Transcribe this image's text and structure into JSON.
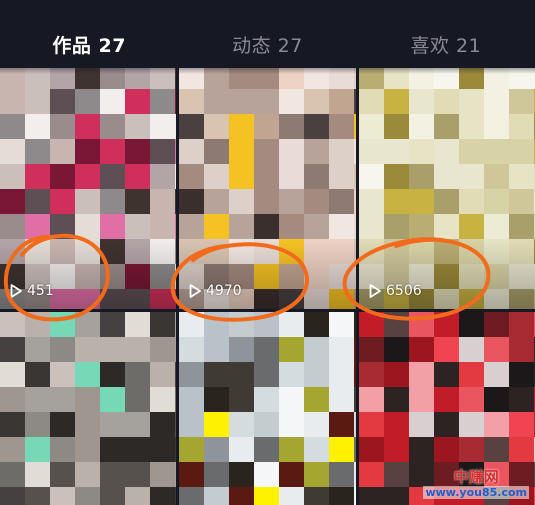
{
  "tabs": [
    {
      "label": "作品 27",
      "active": true
    },
    {
      "label": "动态 27",
      "active": false
    },
    {
      "label": "喜欢 21",
      "active": false
    }
  ],
  "videos": [
    {
      "play_count": "451",
      "palette": [
        "#e4ddd6",
        "#cbbfbb",
        "#b3a4a8",
        "#e06fa6",
        "#7a1736",
        "#cf2f5a",
        "#5d4f53",
        "#9a8c8c",
        "#3f3330",
        "#f2eeee",
        "#c8b5b0",
        "#8e8a8b"
      ]
    },
    {
      "play_count": "4970",
      "palette": [
        "#c2a590",
        "#d9c4b2",
        "#eed2c4",
        "#f5c224",
        "#3a2f2c",
        "#ddd0c9",
        "#8d7a72",
        "#b8a39a",
        "#f1e6e0",
        "#a58a7f",
        "#4a4040",
        "#e9dcd6"
      ]
    },
    {
      "play_count": "6506",
      "palette": [
        "#ecebd3",
        "#e6e4c4",
        "#d8d3a6",
        "#c8b242",
        "#9b8a39",
        "#f2f1e2",
        "#b9ad72",
        "#e1dcb6",
        "#f7f6ec",
        "#a89f6a",
        "#cfc79a",
        "#e9e6cf"
      ]
    },
    {
      "play_count": null,
      "palette": [
        "#6d6c69",
        "#8d8a86",
        "#3a3634",
        "#76d8b7",
        "#ccc0bd",
        "#9f9690",
        "#2d2926",
        "#b9b1aa",
        "#56514d",
        "#e2dcd6",
        "#454140",
        "#a5a19d"
      ]
    },
    {
      "play_count": null,
      "palette": [
        "#3f3a34",
        "#b9c2c8",
        "#e9ecee",
        "#fff200",
        "#a5a62f",
        "#d5dcdf",
        "#5a1a12",
        "#2a241f",
        "#8e9499",
        "#f4f6f7",
        "#6a6b6c",
        "#c5ccd0"
      ]
    },
    {
      "play_count": null,
      "palette": [
        "#c21c28",
        "#e23a40",
        "#9c1620",
        "#1c1718",
        "#f04452",
        "#6d1c21",
        "#d8d0d0",
        "#5a4141",
        "#ea5660",
        "#a82a32",
        "#2e2323",
        "#f2a0a6"
      ]
    }
  ],
  "watermark": {
    "name": "中赚网",
    "url": "www.you85.com"
  }
}
